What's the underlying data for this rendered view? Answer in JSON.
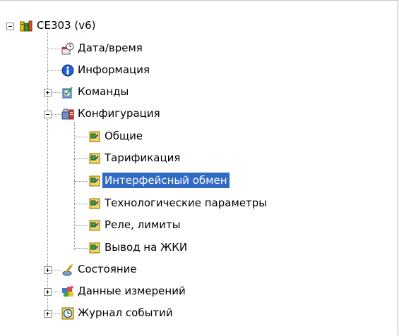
{
  "tree": {
    "root": {
      "label": "CE303 (v6)",
      "icon": "meter-device-icon",
      "expanded": true
    },
    "items": [
      {
        "label": "Дата/время",
        "icon": "clock-calendar-icon"
      },
      {
        "label": "Информация",
        "icon": "info-icon"
      },
      {
        "label": "Команды",
        "icon": "commands-icon",
        "expandable": true,
        "expanded": false
      },
      {
        "label": "Конфигурация",
        "icon": "configuration-icon",
        "expandable": true,
        "expanded": true,
        "children": [
          {
            "label": "Общие",
            "icon": "settings-leaf-icon"
          },
          {
            "label": "Тарификация",
            "icon": "settings-leaf-icon"
          },
          {
            "label": "Интерфейсный обмен",
            "icon": "settings-leaf-icon",
            "selected": true
          },
          {
            "label": "Технологические параметры",
            "icon": "settings-leaf-icon"
          },
          {
            "label": "Реле, лимиты",
            "icon": "settings-leaf-icon"
          },
          {
            "label": "Вывод на ЖКИ",
            "icon": "settings-leaf-icon"
          }
        ]
      },
      {
        "label": "Состояние",
        "icon": "status-icon",
        "expandable": true,
        "expanded": false
      },
      {
        "label": "Данные измерений",
        "icon": "measurements-icon",
        "expandable": true,
        "expanded": false
      },
      {
        "label": "Журнал событий",
        "icon": "event-log-icon",
        "expandable": true,
        "expanded": false
      }
    ]
  },
  "colors": {
    "selection_bg": "#316ac5",
    "selection_text": "#ffffff",
    "tree_line": "#8a8a8a"
  }
}
